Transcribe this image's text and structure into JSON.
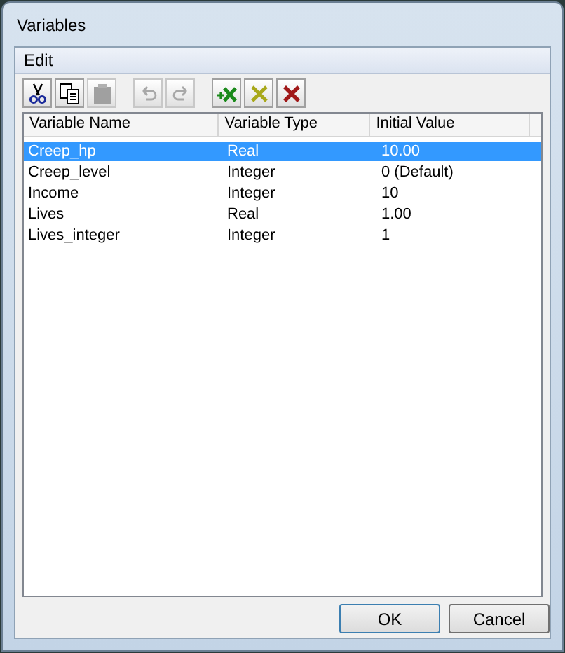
{
  "window": {
    "title": "Variables"
  },
  "menu": [
    {
      "label": "Edit"
    }
  ],
  "toolbar": [
    {
      "kind": "cut",
      "disabled": false
    },
    {
      "kind": "copy",
      "disabled": false
    },
    {
      "kind": "paste",
      "disabled": true
    },
    {
      "kind": "sep"
    },
    {
      "kind": "undo",
      "disabled": true
    },
    {
      "kind": "redo",
      "disabled": true
    },
    {
      "kind": "sep"
    },
    {
      "kind": "new",
      "disabled": false
    },
    {
      "kind": "edit",
      "disabled": false
    },
    {
      "kind": "delete",
      "disabled": false
    }
  ],
  "table": {
    "columns": [
      "Variable Name",
      "Variable Type",
      "Initial Value"
    ],
    "rows": [
      {
        "cells": [
          "Creep_hp",
          "Real",
          "10.00"
        ],
        "selected": true
      },
      {
        "cells": [
          "Creep_level",
          "Integer",
          "0 (Default)"
        ],
        "selected": false
      },
      {
        "cells": [
          "Income",
          "Integer",
          "10"
        ],
        "selected": false
      },
      {
        "cells": [
          "Lives",
          "Real",
          "1.00"
        ],
        "selected": false
      },
      {
        "cells": [
          "Lives_integer",
          "Integer",
          "1"
        ],
        "selected": false
      }
    ]
  },
  "buttons": [
    {
      "label": "OK"
    },
    {
      "label": "Cancel"
    }
  ]
}
